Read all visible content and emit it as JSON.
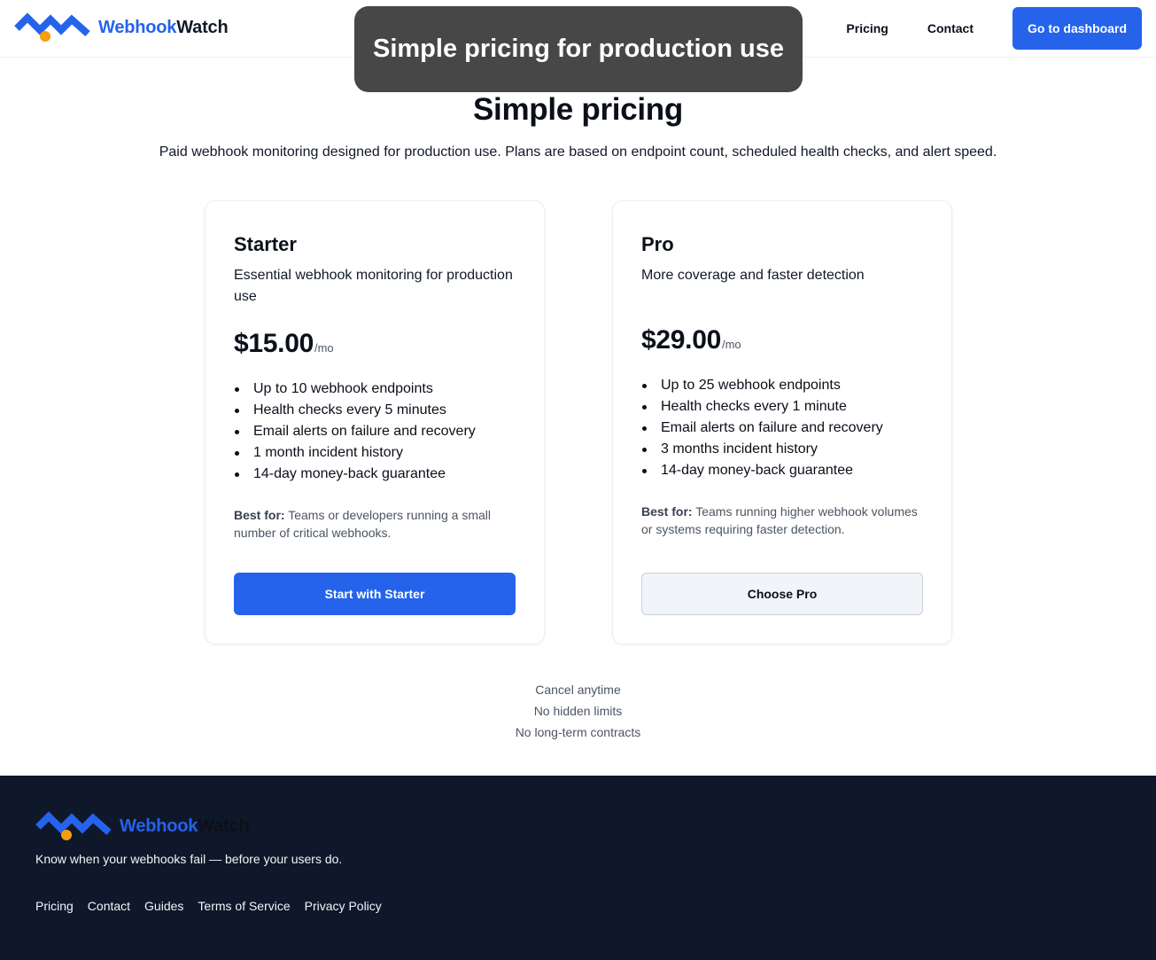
{
  "brand": {
    "name_part1": "Webhook",
    "name_part2": "Watch"
  },
  "nav": {
    "links": [
      "Pricing",
      "Contact"
    ],
    "cta_label": "Go to dashboard"
  },
  "tooltip": {
    "text": "Simple pricing for production use"
  },
  "hero": {
    "title": "Simple pricing",
    "subtitle": "Paid webhook monitoring designed for production use. Plans are based on endpoint count, scheduled health checks, and alert speed."
  },
  "plans": [
    {
      "name": "Starter",
      "description": "Essential webhook monitoring for production use",
      "price": "$15.00",
      "period": "/mo",
      "features": [
        "Up to 10 webhook endpoints",
        "Health checks every 5 minutes",
        "Email alerts on failure and recovery",
        "1 month incident history",
        "14-day money-back guarantee"
      ],
      "best_for_label": "Best for:",
      "best_for_text": "Teams or developers running a small number of critical webhooks.",
      "cta_label": "Start with Starter"
    },
    {
      "name": "Pro",
      "description": "More coverage and faster detection",
      "price": "$29.00",
      "period": "/mo",
      "features": [
        "Up to 25 webhook endpoints",
        "Health checks every 1 minute",
        "Email alerts on failure and recovery",
        "3 months incident history",
        "14-day money-back guarantee"
      ],
      "best_for_label": "Best for:",
      "best_for_text": "Teams running higher webhook volumes or systems requiring faster detection.",
      "cta_label": "Choose Pro"
    }
  ],
  "assurances": [
    "Cancel anytime",
    "No hidden limits",
    "No long-term contracts"
  ],
  "footer": {
    "tagline": "Know when your webhooks fail — before your users do.",
    "links": [
      "Pricing",
      "Contact",
      "Guides",
      "Terms of Service",
      "Privacy Policy"
    ]
  },
  "colors": {
    "accent": "#2563eb",
    "logo_dot": "#f59e0b",
    "footer_bg": "#0f172a",
    "tooltip_bg": "#474747"
  },
  "icons": {
    "logo": "wave-logo-icon",
    "bullet": "bullet-dot-icon"
  }
}
